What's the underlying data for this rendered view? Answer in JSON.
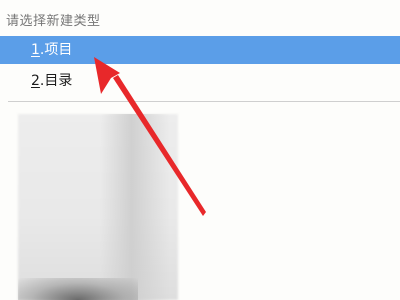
{
  "menu": {
    "header": "请选择新建类型",
    "items": [
      {
        "accelerator": "1",
        "label": ".项目",
        "selected": true
      },
      {
        "accelerator": "2",
        "label": ".目录",
        "selected": false
      }
    ]
  },
  "colors": {
    "selection": "#5b9ee8",
    "arrow": "#e8282a"
  },
  "annotation": {
    "icon": "red-arrow-icon"
  }
}
